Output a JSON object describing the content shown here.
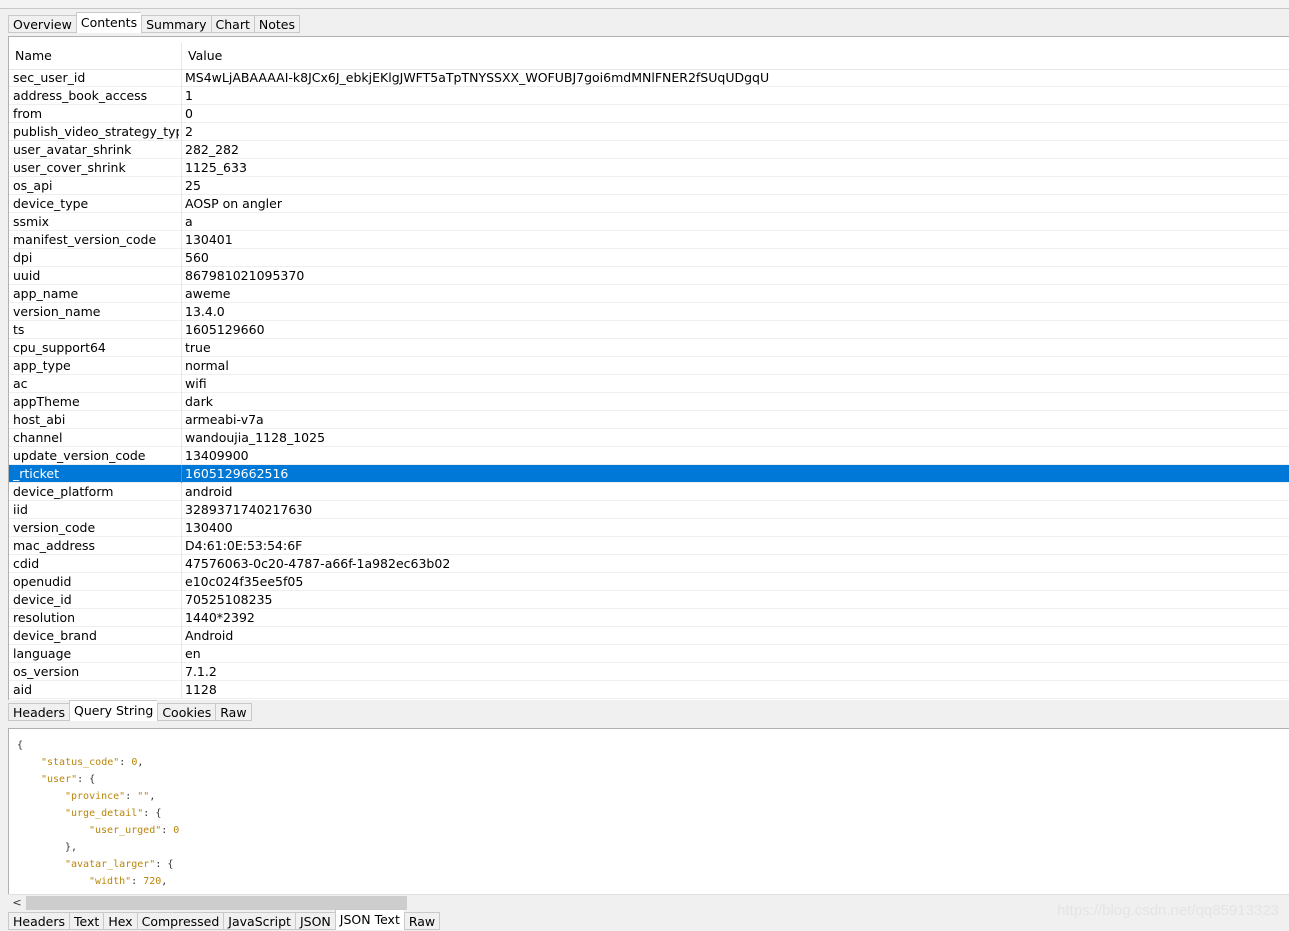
{
  "top_tabs": [
    "Overview",
    "Contents",
    "Summary",
    "Chart",
    "Notes"
  ],
  "table": {
    "headers": {
      "name": "Name",
      "value": "Value"
    },
    "rows": [
      [
        "sec_user_id",
        "MS4wLjABAAAAI-k8JCx6J_ebkjEKlgJWFT5aTpTNYSSXX_WOFUBJ7goi6mdMNlFNER2fSUqUDgqU"
      ],
      [
        "address_book_access",
        "1"
      ],
      [
        "from",
        "0"
      ],
      [
        "publish_video_strategy_type",
        "2"
      ],
      [
        "user_avatar_shrink",
        "282_282"
      ],
      [
        "user_cover_shrink",
        "1125_633"
      ],
      [
        "os_api",
        "25"
      ],
      [
        "device_type",
        "AOSP on angler"
      ],
      [
        "ssmix",
        "a"
      ],
      [
        "manifest_version_code",
        "130401"
      ],
      [
        "dpi",
        "560"
      ],
      [
        "uuid",
        "867981021095370"
      ],
      [
        "app_name",
        "aweme"
      ],
      [
        "version_name",
        "13.4.0"
      ],
      [
        "ts",
        "1605129660"
      ],
      [
        "cpu_support64",
        "true"
      ],
      [
        "app_type",
        "normal"
      ],
      [
        "ac",
        "wifi"
      ],
      [
        "appTheme",
        "dark"
      ],
      [
        "host_abi",
        "armeabi-v7a"
      ],
      [
        "channel",
        "wandoujia_1128_1025"
      ],
      [
        "update_version_code",
        "13409900"
      ],
      [
        "_rticket",
        "1605129662516"
      ],
      [
        "device_platform",
        "android"
      ],
      [
        "iid",
        "3289371740217630"
      ],
      [
        "version_code",
        "130400"
      ],
      [
        "mac_address",
        "D4:61:0E:53:54:6F"
      ],
      [
        "cdid",
        "47576063-0c20-4787-a66f-1a982ec63b02"
      ],
      [
        "openudid",
        "e10c024f35ee5f05"
      ],
      [
        "device_id",
        "70525108235"
      ],
      [
        "resolution",
        "1440*2392"
      ],
      [
        "device_brand",
        "Android"
      ],
      [
        "language",
        "en"
      ],
      [
        "os_version",
        "7.1.2"
      ],
      [
        "aid",
        "1128"
      ]
    ],
    "selected_row": 22
  },
  "request_tabs": [
    "Headers",
    "Query String",
    "Cookies",
    "Raw"
  ],
  "json_lines": [
    [
      {
        "t": "{",
        "c": "p"
      }
    ],
    [
      {
        "t": "\"status_code\"",
        "c": "k"
      },
      {
        "t": ": ",
        "c": "p"
      },
      {
        "t": "0",
        "c": "n"
      },
      {
        "t": ",",
        "c": "p"
      }
    ],
    [
      {
        "t": "\"user\"",
        "c": "k"
      },
      {
        "t": ": {",
        "c": "p"
      }
    ],
    [
      {
        "t": "\"province\"",
        "c": "k"
      },
      {
        "t": ": ",
        "c": "p"
      },
      {
        "t": "\"\"",
        "c": "k"
      },
      {
        "t": ",",
        "c": "p"
      }
    ],
    [
      {
        "t": "\"urge_detail\"",
        "c": "k"
      },
      {
        "t": ": {",
        "c": "p"
      }
    ],
    [
      {
        "t": "\"user_urged\"",
        "c": "k"
      },
      {
        "t": ": ",
        "c": "p"
      },
      {
        "t": "0",
        "c": "n"
      }
    ],
    [
      {
        "t": "},",
        "c": "p"
      }
    ],
    [
      {
        "t": "\"avatar_larger\"",
        "c": "k"
      },
      {
        "t": ": {",
        "c": "p"
      }
    ],
    [
      {
        "t": "\"width\"",
        "c": "k"
      },
      {
        "t": ": ",
        "c": "p"
      },
      {
        "t": "720",
        "c": "n"
      },
      {
        "t": ",",
        "c": "p"
      }
    ]
  ],
  "json_indents": [
    0,
    1,
    1,
    2,
    2,
    3,
    2,
    2,
    3
  ],
  "scrollbar": {
    "left_arrow": "<"
  },
  "response_tabs": [
    "Headers",
    "Text",
    "Hex",
    "Compressed",
    "JavaScript",
    "JSON",
    "JSON Text",
    "Raw"
  ],
  "active_tabs": {
    "top": 1,
    "request": 1,
    "response": 6
  },
  "watermark": "https://blog.csdn.net/qq85913323"
}
